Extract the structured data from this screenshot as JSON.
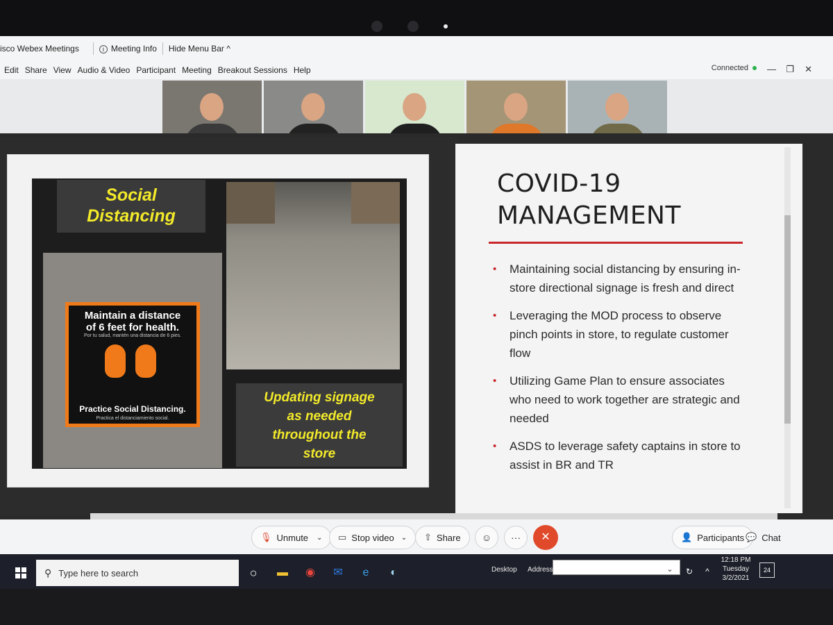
{
  "titlebar": {
    "app_title": "isco Webex Meetings",
    "meeting_info": "Meeting Info",
    "hide_menu": "Hide Menu Bar ^"
  },
  "menu": [
    "Edit",
    "Share",
    "View",
    "Audio & Video",
    "Participant",
    "Meeting",
    "Breakout Sessions",
    "Help"
  ],
  "status": {
    "connected": "Connected"
  },
  "slide": {
    "sign_top": [
      "Social",
      "Distancing"
    ],
    "decal": {
      "headline": [
        "Maintain a distance",
        "of 6 feet for health."
      ],
      "spanish_top": "Por tu salud, mantén una distancia de 6 pies.",
      "footer": "Practice Social Distancing.",
      "spanish_bottom": "Practica el distanciamiento social."
    },
    "sign_bottom": [
      "Updating signage",
      "as needed",
      "throughout the",
      "store"
    ],
    "title": [
      "COVID-19",
      "MANAGEMENT"
    ],
    "bullets": [
      "Maintaining social distancing by ensuring in-store directional signage is fresh and direct",
      "Leveraging the MOD process to observe pinch points in store, to regulate customer flow",
      "Utilizing Game Plan to ensure associates who need to work together are strategic and needed",
      "ASDS to leverage safety captains in store to assist in BR and TR"
    ],
    "accent_color": "#c8262b"
  },
  "controls": {
    "unmute": "Unmute",
    "stop_video": "Stop video",
    "share": "Share",
    "participants": "Participants",
    "chat": "Chat"
  },
  "taskbar": {
    "search_placeholder": "Type here to search",
    "desktop": "Desktop",
    "address": "Address",
    "time": "12:18 PM",
    "day": "Tuesday",
    "date": "3/2/2021",
    "notifications": "24"
  }
}
